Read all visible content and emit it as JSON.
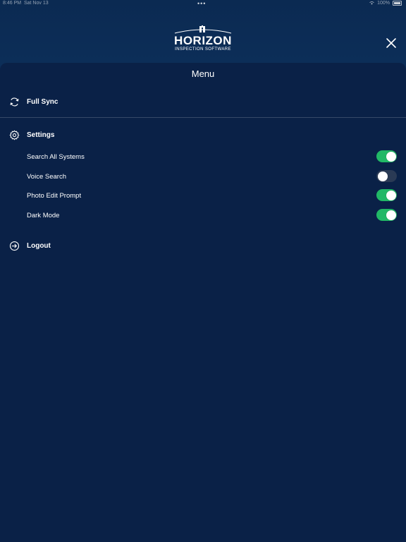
{
  "status_bar": {
    "time": "8:46 PM",
    "date": "Sat Nov 13",
    "battery": "100%",
    "battery_level": 1.0
  },
  "header": {
    "logo_word": "HORIZON",
    "logo_sub": "INSPECTION SOFTWARE",
    "close_icon": "close-icon"
  },
  "menu": {
    "title": "Menu",
    "full_sync": {
      "label": "Full Sync",
      "icon": "sync-icon"
    },
    "settings": {
      "label": "Settings",
      "icon": "gear-icon",
      "options": [
        {
          "label": "Search All Systems",
          "enabled": true
        },
        {
          "label": "Voice Search",
          "enabled": false
        },
        {
          "label": "Photo Edit Prompt",
          "enabled": true
        },
        {
          "label": "Dark Mode",
          "enabled": true
        }
      ]
    },
    "logout": {
      "label": "Logout",
      "icon": "logout-icon"
    }
  },
  "colors": {
    "toggle_on": "#21b866",
    "toggle_off": "#2a3a55",
    "sheet_background": "#0a2147",
    "header_background": "#123c6e"
  }
}
